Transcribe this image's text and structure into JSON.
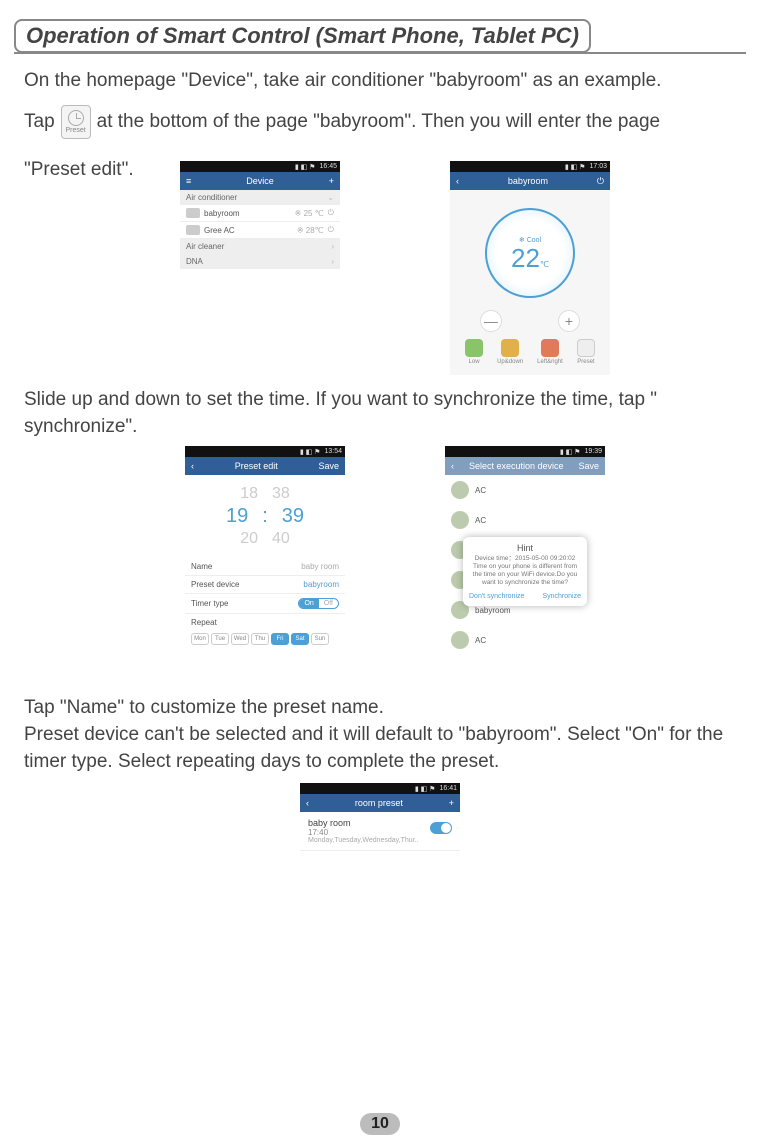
{
  "page_title": "Operation of Smart Control (Smart Phone, Tablet PC)",
  "page_number": "10",
  "paras": {
    "p1": "On the homepage \"Device\", take air conditioner \"babyroom\" as an example.",
    "p2a": "Tap",
    "p2b": "at the bottom of the page \"babyroom\". Then you will enter the page",
    "p2c": "\"Preset edit\".",
    "p3": "Slide up and down to set the time. If you want to synchronize the time, tap \" synchronize\".",
    "p4": "Tap \"Name\" to customize the preset name.",
    "p5": "Preset device can't be selected and it will default to \"babyroom\". Select \"On\" for the timer type. Select repeating days to complete the preset."
  },
  "preset_icon_label": "Preset",
  "shot_device": {
    "status_time": "16:45",
    "title": "Device",
    "menu_left": "≡",
    "menu_right": "+",
    "section1": "Air conditioner",
    "row1_name": "babyroom",
    "row1_temp": "※ 25 ℃",
    "row2_name": "Gree AC",
    "row2_temp": "※ 28℃",
    "section2": "Air cleaner",
    "section3": "DNA"
  },
  "shot_babyroom": {
    "status_time": "17:03",
    "back": "‹",
    "title": "babyroom",
    "power": "⏻",
    "mode": "❄ Cool",
    "temp": "22",
    "unit": "℃",
    "minus": "—",
    "plus": "+",
    "icons": [
      "Low",
      "Up&down",
      "Left&right",
      "Preset"
    ]
  },
  "shot_preset_edit": {
    "status_time": "13:54",
    "back": "‹",
    "title": "Preset edit",
    "save": "Save",
    "times": {
      "above": {
        "h": "18",
        "m": "38"
      },
      "sel": {
        "h": "19",
        "m": "39"
      },
      "below": {
        "h": "20",
        "m": "40"
      }
    },
    "rows": {
      "name_label": "Name",
      "name_value": "baby room",
      "device_label": "Preset device",
      "device_value": "babyroom",
      "timer_label": "Timer type",
      "on": "On",
      "off": "Off",
      "repeat_label": "Repeat"
    },
    "days": [
      "Mon",
      "Tue",
      "Wed",
      "Thu",
      "Fri",
      "Sat",
      "Sun"
    ],
    "days_sel": [
      false,
      false,
      false,
      false,
      true,
      true,
      false
    ]
  },
  "shot_hint": {
    "status_time": "19:39",
    "back": "‹",
    "title": "Select execution device",
    "save": "Save",
    "rows": [
      "AC",
      "AC",
      "AC",
      "AC",
      "babyroom",
      "AC"
    ],
    "dialog": {
      "title": "Hint",
      "body1": "Device time：2015-05-00 09:20:02",
      "body2": "Time on your phone is different from the time on your WiFi device.Do you want to synchronize the time?",
      "btn_left": "Don't synchronize",
      "btn_right": "Synchronize"
    }
  },
  "shot_room_preset": {
    "status_time": "16:41",
    "back": "‹",
    "title": "room preset",
    "plus": "+",
    "entry": {
      "name": "baby room",
      "time": "17:40",
      "days": "Monday,Tuesday,Wednesday,Thur.."
    }
  }
}
